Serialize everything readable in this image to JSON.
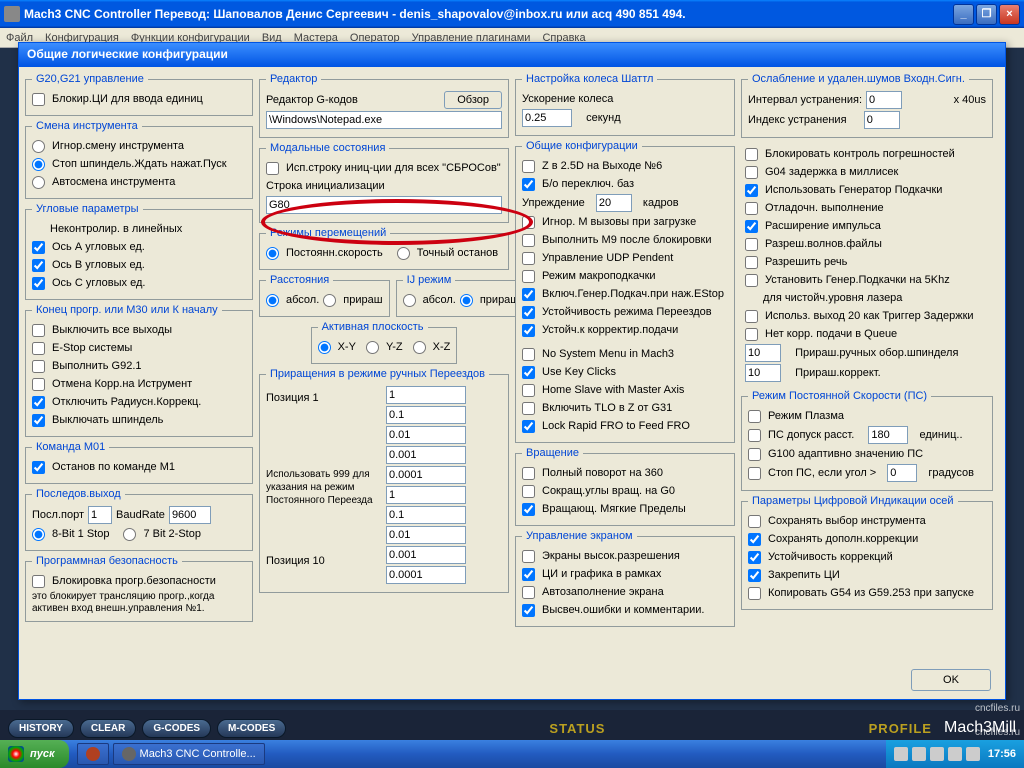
{
  "window": {
    "title": "Mach3 CNC Controller Перевод: Шаповалов Денис Сергеевич - denis_shapovalov@inbox.ru или acq 490 851 494."
  },
  "menu": [
    "Файл",
    "Конфигурация",
    "Функции конфигурации",
    "Вид",
    "Мастера",
    "Оператор",
    "Управление плагинами",
    "Справка"
  ],
  "dialog": {
    "title": "Общие логические конфигурации"
  },
  "g20": {
    "legend": "G20,G21 управление",
    "lock": "Блокир.ЦИ для ввода единиц"
  },
  "tool": {
    "legend": "Смена инструмента",
    "r1": "Игнор.смену инструмента",
    "r2": "Стоп шпиндель.Ждать нажат.Пуск",
    "r3": "Автосмена инструмента"
  },
  "ang": {
    "legend": "Угловые параметры",
    "sub": "Неконтролир. в линейных",
    "a": "Ось А угловых ед.",
    "b": "Ось В угловых ед.",
    "c": "Ось С угловых ед."
  },
  "end": {
    "legend": "Конец прогр. или М30 или К началу",
    "off": "Выключить все выходы",
    "es": "E-Stop системы",
    "g92": "Выполнить G92.1",
    "tool": "Отмена Корр.на Иструмент",
    "rad": "Отключить Радиусн.Коррекц.",
    "sp": "Выключать шпиндель"
  },
  "m01": {
    "legend": "Команда М01",
    "stop": "Останов по команде М1"
  },
  "ser": {
    "legend": "Последов.выход",
    "port": "Посл.порт",
    "portv": "1",
    "baud": "BaudRate",
    "baudv": "9600",
    "r1": "8-Bit 1 Stop",
    "r2": "7 Bit 2-Stop"
  },
  "safe": {
    "legend": "Программная безопасность",
    "lock": "Блокировка прогр.безопасности",
    "note": "это блокирует трансляцию прогр.,когда активен вход внешн.управления №1."
  },
  "editor": {
    "legend": "Редактор",
    "lbl": "Редактор G-кодов",
    "btn": "Обзор",
    "path": "\\Windows\\Notepad.exe"
  },
  "modal": {
    "legend": "Модальные состояния",
    "init": "Исп.строку иниц-ции для всех \"СБРОСов\"",
    "str": "Строка инициализации",
    "val": "G80"
  },
  "move": {
    "legend": "Режимы перемещений",
    "r1": "Постоянн.скорость",
    "r2": "Точный останов"
  },
  "dist": {
    "legend": "Расстояния",
    "a": "абсол.",
    "i": "прираш"
  },
  "ij": {
    "legend": "IJ режим",
    "a": "абсол.",
    "i": "прираш."
  },
  "plane": {
    "legend": "Активная плоскость",
    "xy": "X-Y",
    "yz": "Y-Z",
    "xz": "X-Z"
  },
  "jog": {
    "legend": "Приращения в режиме ручных Переездов",
    "p1": "Позиция 1",
    "vals": [
      "1",
      "0.1",
      "0.01",
      "0.001",
      "0.0001"
    ],
    "use": "Использовать 999 для указания на режим Постоянного Переезда",
    "vals2": [
      "1",
      "0.1",
      "0.01",
      "0.001",
      "0.0001"
    ],
    "p10": "Позиция 10"
  },
  "shuttle": {
    "legend": "Настройка колеса Шаттл",
    "acc": "Ускорение колеса",
    "val": "0.25",
    "sec": "секунд"
  },
  "gen": {
    "legend": "Общие конфигурации",
    "z25": "Z в 2.5D на Выходе №6",
    "bo": "Б/о переключ. баз",
    "look": "Упреждение",
    "lookv": "20",
    "frames": "кадров",
    "igm": "Игнор. М вызовы при загрузке",
    "m9": "Выполнить М9 после блокировки",
    "udp": "Управление UDP Pendent",
    "macro": "Режим макроподкачки",
    "estop": "Включ.Генер.Подкач.при наж.EStop",
    "pers": "Устойчивость режима Переездов",
    "fro": "Устойч.к корректир.подачи",
    "nosys": "No System Menu in Mach3",
    "key": "Use Key Clicks",
    "home": "Home Slave with Master Axis",
    "tlo": "Включить TLO в Z от G31",
    "lock": "Lock Rapid FRO to Feed FRO"
  },
  "rot": {
    "legend": "Вращение",
    "full": "Полный поворот на 360",
    "short": "Сокращ.углы вращ. на G0",
    "soft": "Вращающ. Мягкие Пределы"
  },
  "scr": {
    "legend": "Управление экраном",
    "hi": "Экраны высок.разрешения",
    "box": "ЦИ и графика в рамках",
    "auto": "Автозаполнение экрана",
    "err": "Высвеч.ошибки и комментарии."
  },
  "noise": {
    "legend": "Ослабление и удален.шумов Входн.Сигн.",
    "int": "Интервал устранения:",
    "intv": "0",
    "x40": "x 40us",
    "idx": "Индекс устранения",
    "idxv": "0"
  },
  "gen2": {
    "block": "Блокировать контроль погрешностей",
    "g04": "G04 задержка в миллисек",
    "cp": "Использовать Генератор Подкачки",
    "debug": "Отладочн. выполнение",
    "pulse": "Расширение импульса",
    "wave": "Разреш.волнов.файлы",
    "speech": "Разрешить речь",
    "cp5": "Установить Генер.Подкачки на 5Khz",
    "cp5b": "для чистойч.уровня лазера",
    "out20": "Использ. выход 20 как Триггер Задержки",
    "noq": "Нет корр. подачи в Queue",
    "sp": "Прираш.ручных обор.шпинделя",
    "spv": "10",
    "fro": "Прираш.коррект.",
    "frov": "10"
  },
  "cv": {
    "legend": "Режим Постоянной Скорости (ПС)",
    "plasma": "Режим Плазма",
    "dist": "ПС допуск расст.",
    "distv": "180",
    "un": "единиц..",
    "g100": "G100 адаптивно значению ПС",
    "stop": "Стоп ПС, если угол >",
    "stopv": "0",
    "deg": "градусов"
  },
  "dro": {
    "legend": "Параметры Цифровой Индикации осей",
    "tool": "Сохранять выбор инструмента",
    "comp": "Сохранять дополн.коррекции",
    "pers": "Устойчивость коррекций",
    "lock": "Закрепить ЦИ",
    "copy": "Копировать G54 из G59.253 при запуске"
  },
  "ok": "OK",
  "bottom": {
    "history": "HISTORY",
    "clear": "CLEAR",
    "gcodes": "G-CODES",
    "mcodes": "M-CODES",
    "status": "STATUS",
    "profile": "PROFILE",
    "mach": "Mach3Mill"
  },
  "taskbar": {
    "start": "пуск",
    "task": "Mach3 CNC Controlle...",
    "time": "17:56"
  },
  "wm": "cncfiles.ru"
}
